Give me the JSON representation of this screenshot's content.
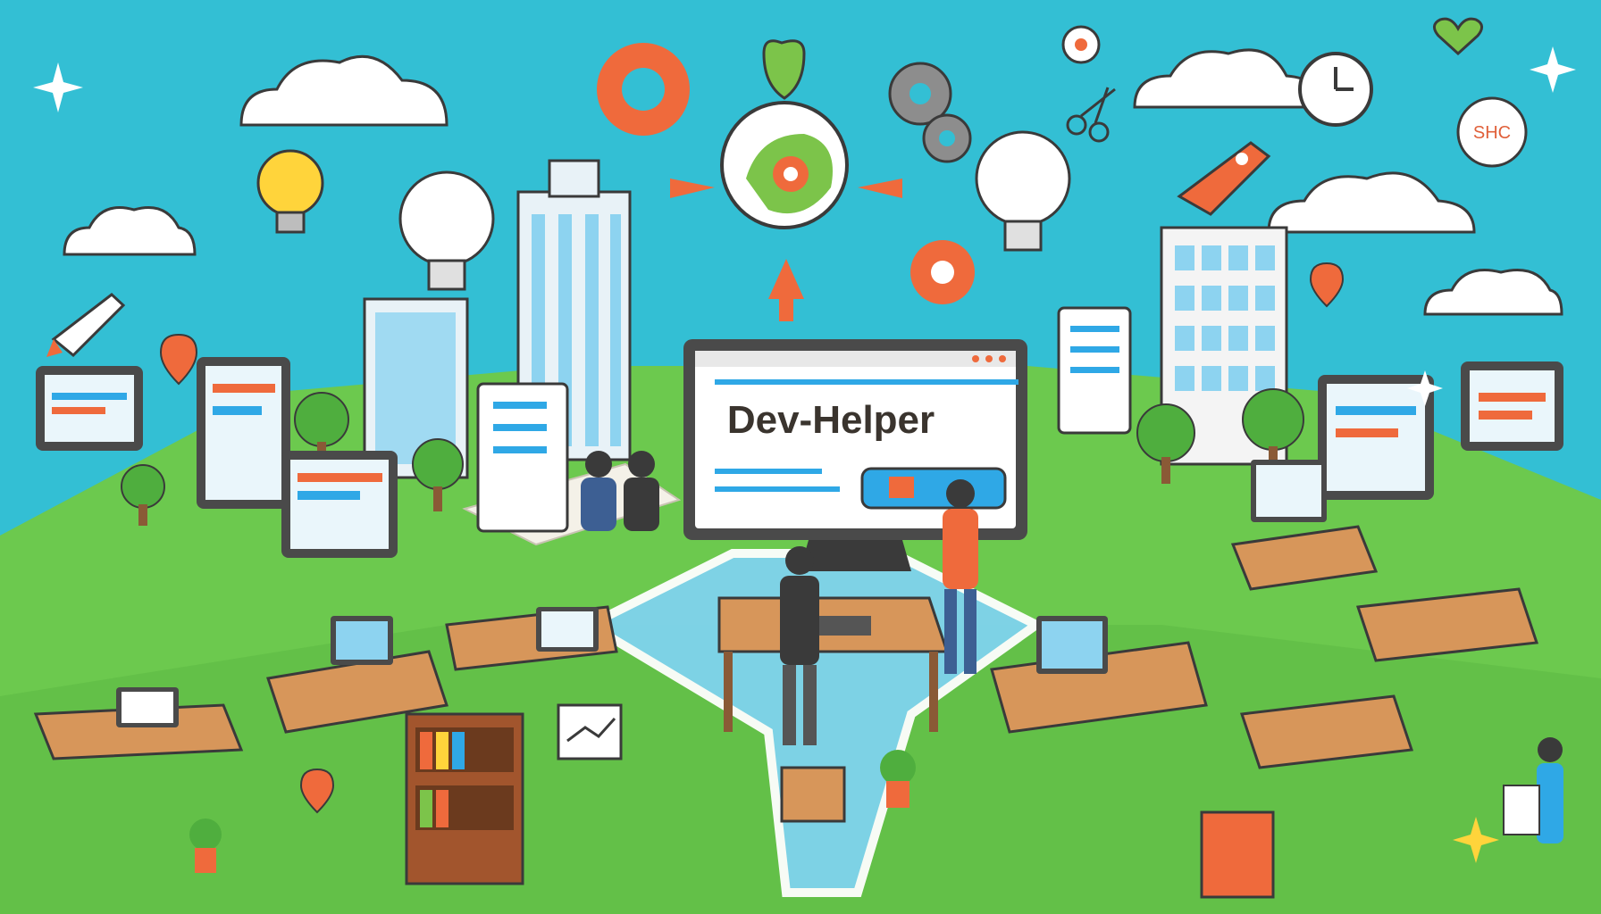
{
  "title": "Dev-Helper",
  "badge_text": "SHC",
  "colors": {
    "sky": "#33bfd4",
    "grass": "#6cc94e",
    "grass_dark": "#4fae3e",
    "accent_orange": "#ef6a3c",
    "monitor_frame": "#4a4a4a",
    "screen_blue": "#2fa8e6",
    "desk_wood": "#d7965a",
    "path_blue": "#7fd3ee"
  },
  "icons": [
    "gear-icon",
    "lightbulb-icon",
    "rocket-icon",
    "cloud-icon",
    "clock-icon",
    "heart-icon",
    "location-pin-icon",
    "scissors-icon",
    "shield-icon"
  ]
}
